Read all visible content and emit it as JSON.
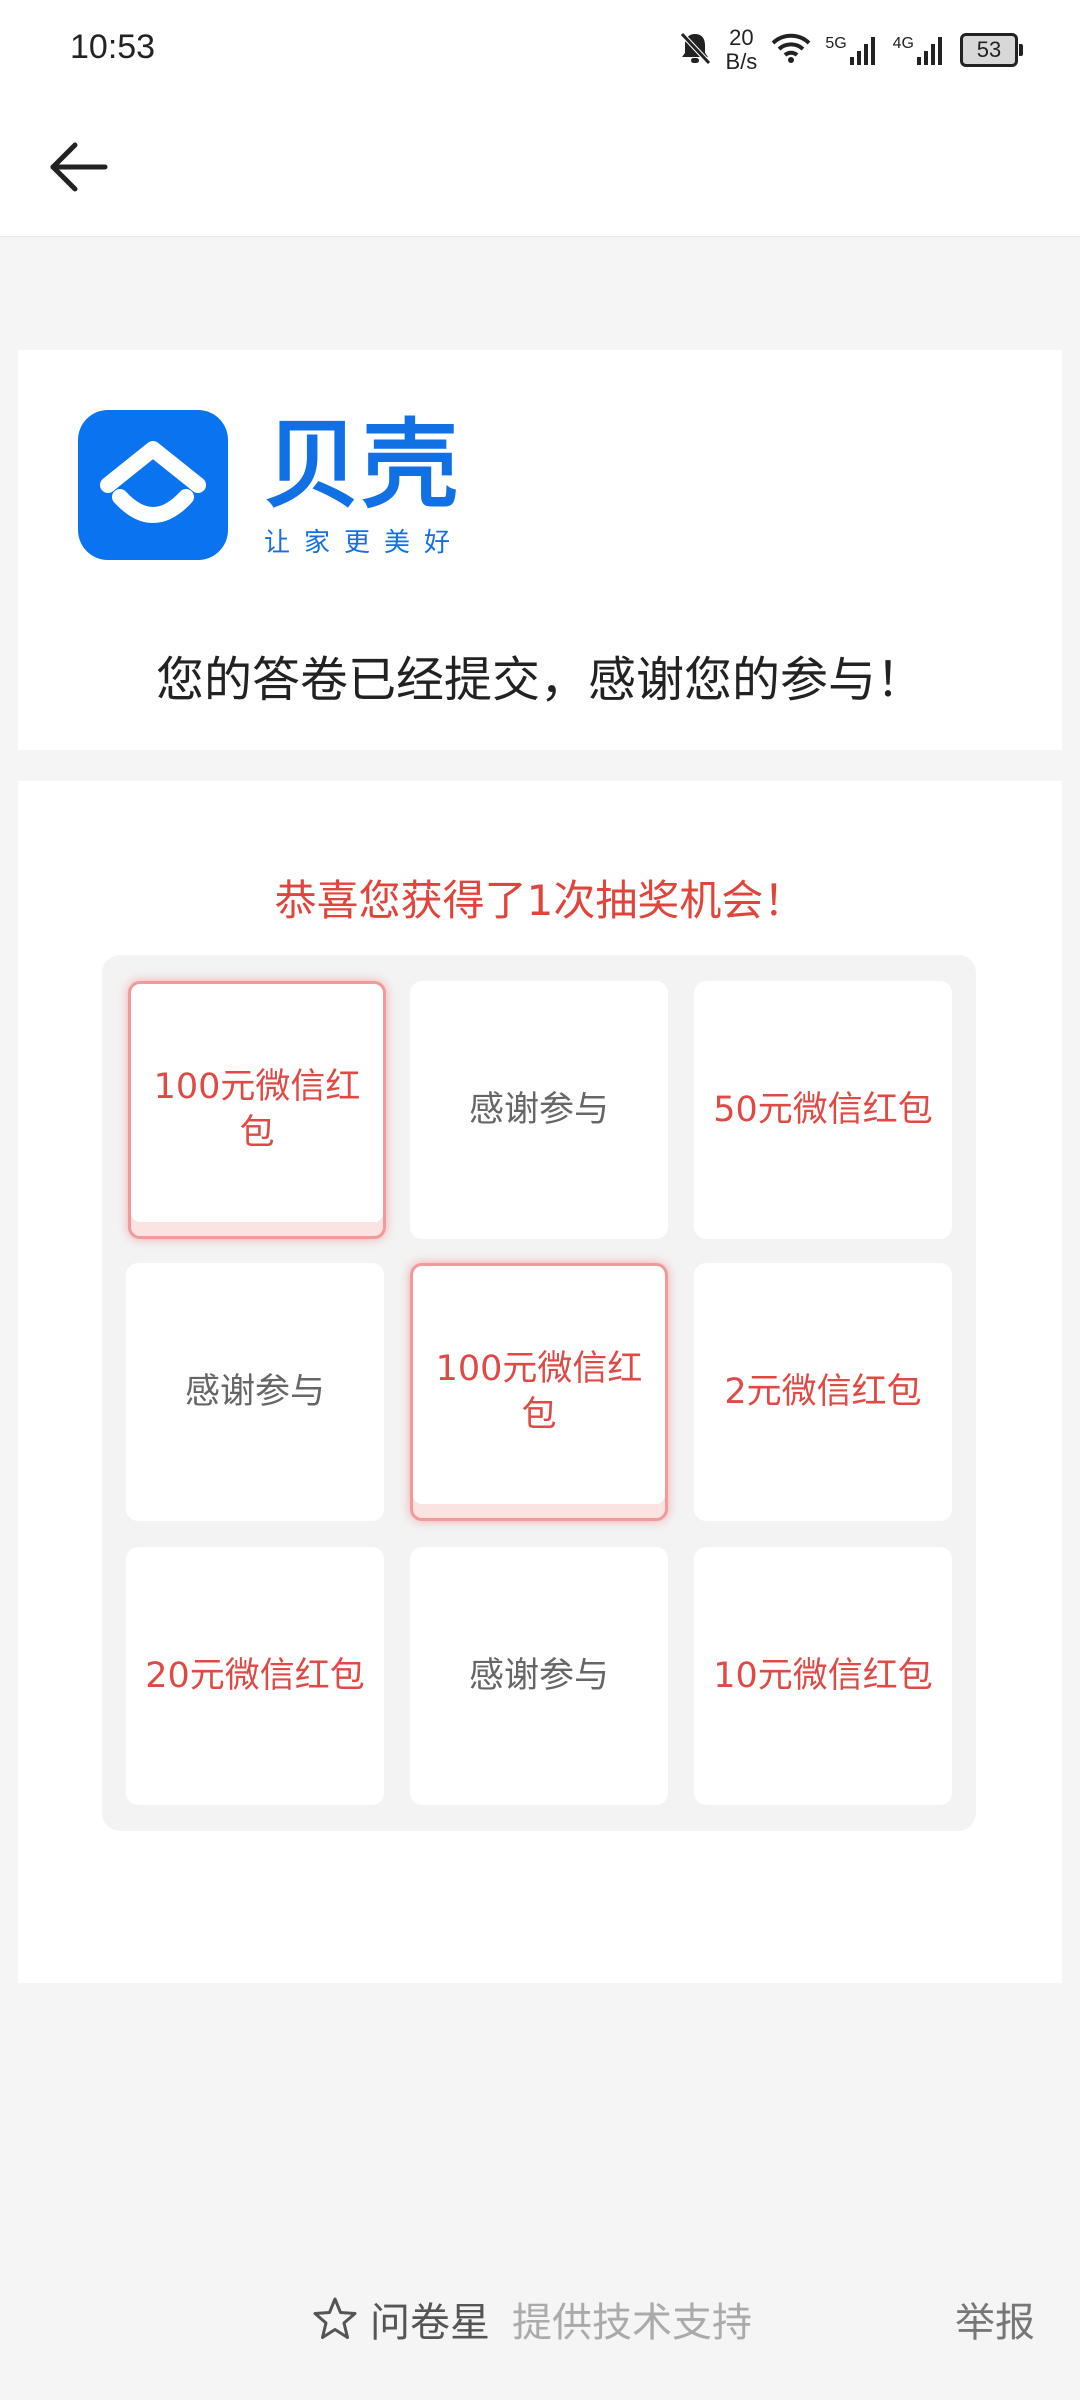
{
  "status_bar": {
    "time": "10:53",
    "net_speed_value": "20",
    "net_speed_unit": "B/s",
    "signal1_label": "5G",
    "signal2_label": "4G",
    "battery": "53",
    "icons": [
      "mute-bell-icon",
      "wifi-icon",
      "signal-icon",
      "battery-icon"
    ]
  },
  "nav": {
    "back_icon": "arrow-left-icon"
  },
  "brand": {
    "name": "贝壳",
    "slogan": "让家更美好",
    "color": "#0a73f0"
  },
  "submitted_message": "您的答卷已经提交，感谢您的参与！",
  "lottery": {
    "title": "恭喜您获得了1次抽奖机会！",
    "title_color": "#e0443a",
    "cells": [
      {
        "label": "100元微信红包",
        "type": "prize",
        "highlighted": true
      },
      {
        "label": "感谢参与",
        "type": "thanks",
        "highlighted": false
      },
      {
        "label": "50元微信红包",
        "type": "prize",
        "highlighted": false
      },
      {
        "label": "感谢参与",
        "type": "thanks",
        "highlighted": false
      },
      {
        "label": "100元微信红包",
        "type": "prize",
        "highlighted": true
      },
      {
        "label": "2元微信红包",
        "type": "prize",
        "highlighted": false
      },
      {
        "label": "20元微信红包",
        "type": "prize",
        "highlighted": false
      },
      {
        "label": "感谢参与",
        "type": "thanks",
        "highlighted": false
      },
      {
        "label": "10元微信红包",
        "type": "prize",
        "highlighted": false
      }
    ]
  },
  "footer": {
    "brand": "问卷星",
    "support_text": "提供技术支持",
    "report_label": "举报",
    "star_icon": "star-outline-icon"
  }
}
